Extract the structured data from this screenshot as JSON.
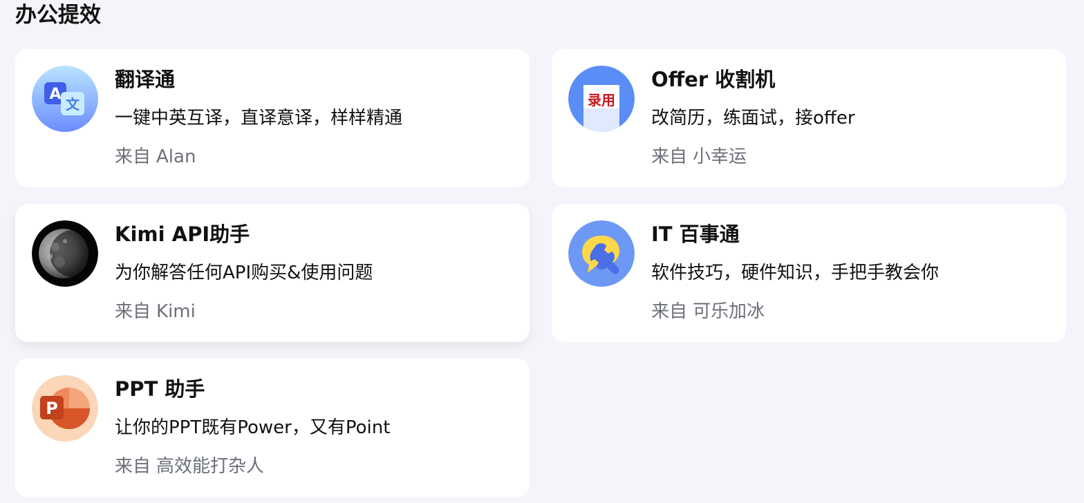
{
  "section": {
    "title": "办公提效"
  },
  "cards": [
    {
      "name": "翻译通",
      "description": "一键中英互译，直译意译，样样精通",
      "from_label": "来自",
      "author": "Alan",
      "icon": "translate-icon"
    },
    {
      "name": "Offer 收割机",
      "description": "改简历，练面试，接offer",
      "from_label": "来自",
      "author": "小幸运",
      "icon": "offer-hired-icon",
      "icon_text": "录用"
    },
    {
      "name": "Kimi API助手",
      "description": "为你解答任何API购买&使用问题",
      "from_label": "来自",
      "author": "Kimi",
      "icon": "moon-icon"
    },
    {
      "name": "IT 百事通",
      "description": "软件技巧，硬件知识，手把手教会你",
      "from_label": "来自",
      "author": "可乐加冰",
      "icon": "wrench-chat-icon"
    },
    {
      "name": "PPT 助手",
      "description": "让你的PPT既有Power，又有Point",
      "from_label": "来自",
      "author": "高效能打杂人",
      "icon": "powerpoint-icon",
      "icon_text": "P"
    }
  ],
  "colors": {
    "background": "#f4f5fa",
    "card": "#ffffff",
    "author_text": "#6b6f78",
    "translate_blue": "#5b8cff",
    "ppt_orange": "#d9562b"
  }
}
